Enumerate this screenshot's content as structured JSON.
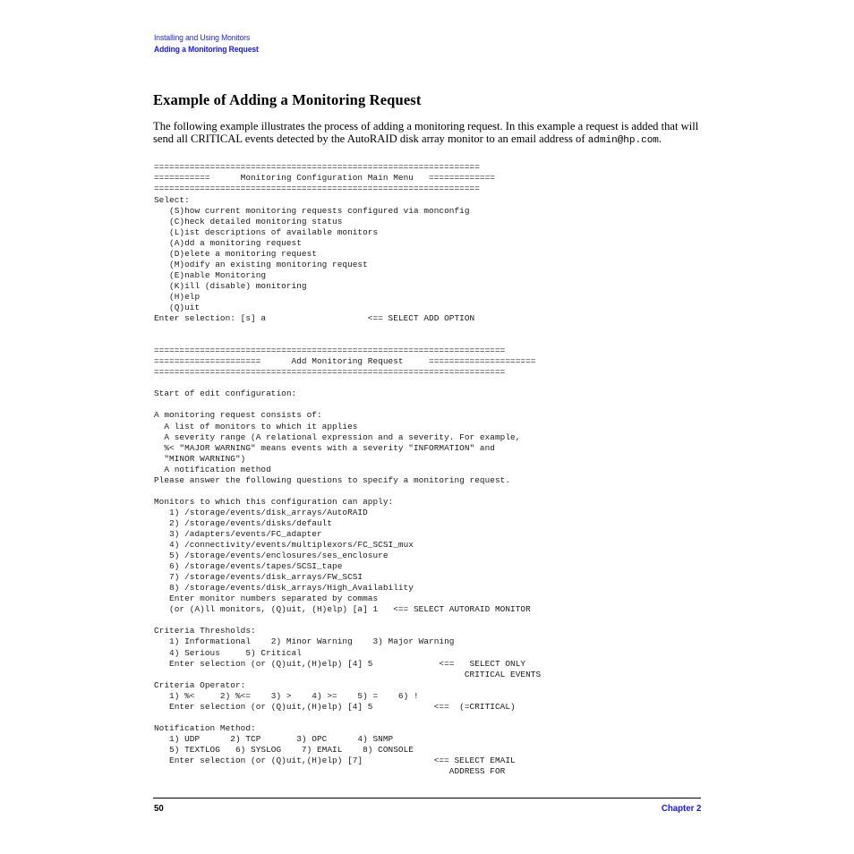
{
  "document": {
    "page_number": "50",
    "chapter_label": "Chapter 2",
    "running_head_top": "Installing and Using Monitors",
    "running_head_sub": "Adding a Monitoring Request",
    "section_title": "Example of Adding a Monitoring Request",
    "accent_color_blue": "#1414FF",
    "text_color": "#000000"
  },
  "intro": {
    "part1": "The following example illustrates the process of adding a monitoring request. In this example a request is added that will send all CRITICAL events detected by the AutoRAID disk array monitor to an email address of ",
    "email": "admin@hp.com",
    "part2": "."
  },
  "listing": {
    "text": "================================================================\n===========      Monitoring Configuration Main Menu   =============\n================================================================\nSelect:\n   (S)how current monitoring requests configured via monconfig\n   (C)heck detailed monitoring status\n   (L)ist descriptions of available monitors\n   (A)dd a monitoring request\n   (D)elete a monitoring request\n   (M)odify an existing monitoring request\n   (E)nable Monitoring\n   (K)ill (disable) monitoring\n   (H)elp\n   (Q)uit\nEnter selection: [s] a                    <== SELECT ADD OPTION\n\n\n=====================================================================\n=====================      Add Monitoring Request     =====================\n=====================================================================\n\nStart of edit configuration:\n\nA monitoring request consists of:\n  A list of monitors to which it applies\n  A severity range (A relational expression and a severity. For example,\n  %< \"MAJOR WARNING\" means events with a severity \"INFORMATION\" and\n  \"MINOR WARNING\")\n  A notification method\nPlease answer the following questions to specify a monitoring request.\n\nMonitors to which this configuration can apply:\n   1) /storage/events/disk_arrays/AutoRAID\n   2) /storage/events/disks/default\n   3) /adapters/events/FC_adapter\n   4) /connectivity/events/multiplexors/FC_SCSI_mux\n   5) /storage/events/enclosures/ses_enclosure\n   6) /storage/events/tapes/SCSI_tape\n   7) /storage/events/disk_arrays/FW_SCSI\n   8) /storage/events/disk_arrays/High_Availability\n   Enter monitor numbers separated by commas\n   (or (A)ll monitors, (Q)uit, (H)elp) [a] 1   <== SELECT AUTORAID MONITOR\n\nCriteria Thresholds:\n   1) Informational    2) Minor Warning    3) Major Warning\n   4) Serious     5) Critical\n   Enter selection (or (Q)uit,(H)elp) [4] 5             <==   SELECT ONLY\n                                                             CRITICAL EVENTS\nCriteria Operator:\n   1) %<     2) %<=    3) >    4) >=    5) =    6) !\n   Enter selection (or (Q)uit,(H)elp) [4] 5            <==  (=CRITICAL)\n\nNotification Method:\n   1) UDP      2) TCP       3) OPC      4) SNMP\n   5) TEXTLOG   6) SYSLOG    7) EMAIL    8) CONSOLE\n   Enter selection (or (Q)uit,(H)elp) [7]              <== SELECT EMAIL\n                                                          ADDRESS FOR"
  },
  "listing_lines": [
    "================================================================",
    "===========      Monitoring Configuration Main Menu   =============",
    "================================================================",
    "Select:",
    "   (S)how current monitoring requests configured via monconfig",
    "   (C)heck detailed monitoring status",
    "   (L)ist descriptions of available monitors",
    "   (A)dd a monitoring request",
    "   (D)elete a monitoring request",
    "   (M)odify an existing monitoring request",
    "   (E)nable Monitoring",
    "   (K)ill (disable) monitoring",
    "   (H)elp",
    "   (Q)uit",
    "Enter selection: [s] a                    <== SELECT ADD OPTION",
    "",
    "",
    "=====================================================================",
    "=====================      Add Monitoring Request     =====================",
    "=====================================================================",
    "",
    "Start of edit configuration:",
    "",
    "A monitoring request consists of:",
    "  A list of monitors to which it applies",
    "  A severity range (A relational expression and a severity. For example,",
    "  %< \"MAJOR WARNING\" means events with a severity \"INFORMATION\" and",
    "  \"MINOR WARNING\")",
    "  A notification method",
    "Please answer the following questions to specify a monitoring request.",
    "",
    "Monitors to which this configuration can apply:",
    "   1) /storage/events/disk_arrays/AutoRAID",
    "   2) /storage/events/disks/default",
    "   3) /adapters/events/FC_adapter",
    "   4) /connectivity/events/multiplexors/FC_SCSI_mux",
    "   5) /storage/events/enclosures/ses_enclosure",
    "   6) /storage/events/tapes/SCSI_tape",
    "   7) /storage/events/disk_arrays/FW_SCSI",
    "   8) /storage/events/disk_arrays/High_Availability",
    "   Enter monitor numbers separated by commas",
    "   (or (A)ll monitors, (Q)uit, (H)elp) [a] 1   <== SELECT AUTORAID MONITOR",
    "",
    "Criteria Thresholds:",
    "   1) Informational    2) Minor Warning    3) Major Warning",
    "   4) Serious     5) Critical",
    "   Enter selection (or (Q)uit,(H)elp) [4] 5             <==   SELECT ONLY",
    "                                                             CRITICAL EVENTS",
    "Criteria Operator:",
    "   1) %<     2) %<=    3) >    4) >=    5) =    6) !",
    "   Enter selection (or (Q)uit,(H)elp) [4] 5            <==  (=CRITICAL)",
    "",
    "Notification Method:",
    "   1) UDP      2) TCP       3) OPC      4) SNMP",
    "   5) TEXTLOG   6) SYSLOG    7) EMAIL    8) CONSOLE",
    "   Enter selection (or (Q)uit,(H)elp) [7]              <== SELECT EMAIL",
    "                                                          ADDRESS FOR"
  ],
  "menu": {
    "title": "Monitoring Configuration Main Menu",
    "prompt": "Select:",
    "options": [
      "(S)how current monitoring requests configured via monconfig",
      "(C)heck detailed monitoring status",
      "(L)ist descriptions of available monitors",
      "(A)dd a monitoring request",
      "(D)elete a monitoring request",
      "(M)odify an existing monitoring request",
      "(E)nable Monitoring",
      "(K)ill (disable) monitoring",
      "(H)elp",
      "(Q)uit"
    ],
    "entry": "Enter selection: [s] a",
    "annotation": "<== SELECT ADD OPTION"
  },
  "add_request": {
    "title": "Add Monitoring Request",
    "start_line": "Start of edit configuration:",
    "consists_of_header": "A monitoring request consists of:",
    "consists_of": [
      "A list of monitors to which it applies",
      "A severity range (A relational expression and a severity. For example,",
      "%< \"MAJOR WARNING\" means events with a severity \"INFORMATION\" and",
      "\"MINOR WARNING\")",
      "A notification method"
    ],
    "please_answer": "Please answer the following questions to specify a monitoring request.",
    "monitors_header": "Monitors to which this configuration can apply:",
    "monitors": [
      "1) /storage/events/disk_arrays/AutoRAID",
      "2) /storage/events/disks/default",
      "3) /adapters/events/FC_adapter",
      "4) /connectivity/events/multiplexors/FC_SCSI_mux",
      "5) /storage/events/enclosures/ses_enclosure",
      "6) /storage/events/tapes/SCSI_tape",
      "7) /storage/events/disk_arrays/FW_SCSI",
      "8) /storage/events/disk_arrays/High_Availability"
    ],
    "monitor_entry_help": "Enter monitor numbers separated by commas",
    "monitor_entry": "(or (A)ll monitors, (Q)uit, (H)elp) [a] 1",
    "monitor_annotation": "<== SELECT AUTORAID MONITOR",
    "thresholds_header": "Criteria Thresholds:",
    "thresholds": [
      "1) Informational",
      "2) Minor Warning",
      "3) Major Warning",
      "4) Serious",
      "5) Critical"
    ],
    "thresholds_entry": "Enter selection (or (Q)uit,(H)elp) [4] 5",
    "thresholds_annotation_1": "<==   SELECT ONLY",
    "thresholds_annotation_2": "CRITICAL EVENTS",
    "operator_header": "Criteria Operator:",
    "operators": [
      "1) %<",
      "2) %<=",
      "3) >",
      "4) >=",
      "5) =",
      "6) !"
    ],
    "operator_entry": "Enter selection (or (Q)uit,(H)elp) [4] 5",
    "operator_annotation": "<==  (=CRITICAL)",
    "notification_header": "Notification Method:",
    "notification_methods": [
      "1) UDP",
      "2) TCP",
      "3) OPC",
      "4) SNMP",
      "5) TEXTLOG",
      "6) SYSLOG",
      "7) EMAIL",
      "8) CONSOLE"
    ],
    "notification_entry": "Enter selection (or (Q)uit,(H)elp) [7]",
    "notification_annotation_1": "<== SELECT EMAIL",
    "notification_annotation_2": "ADDRESS FOR"
  }
}
